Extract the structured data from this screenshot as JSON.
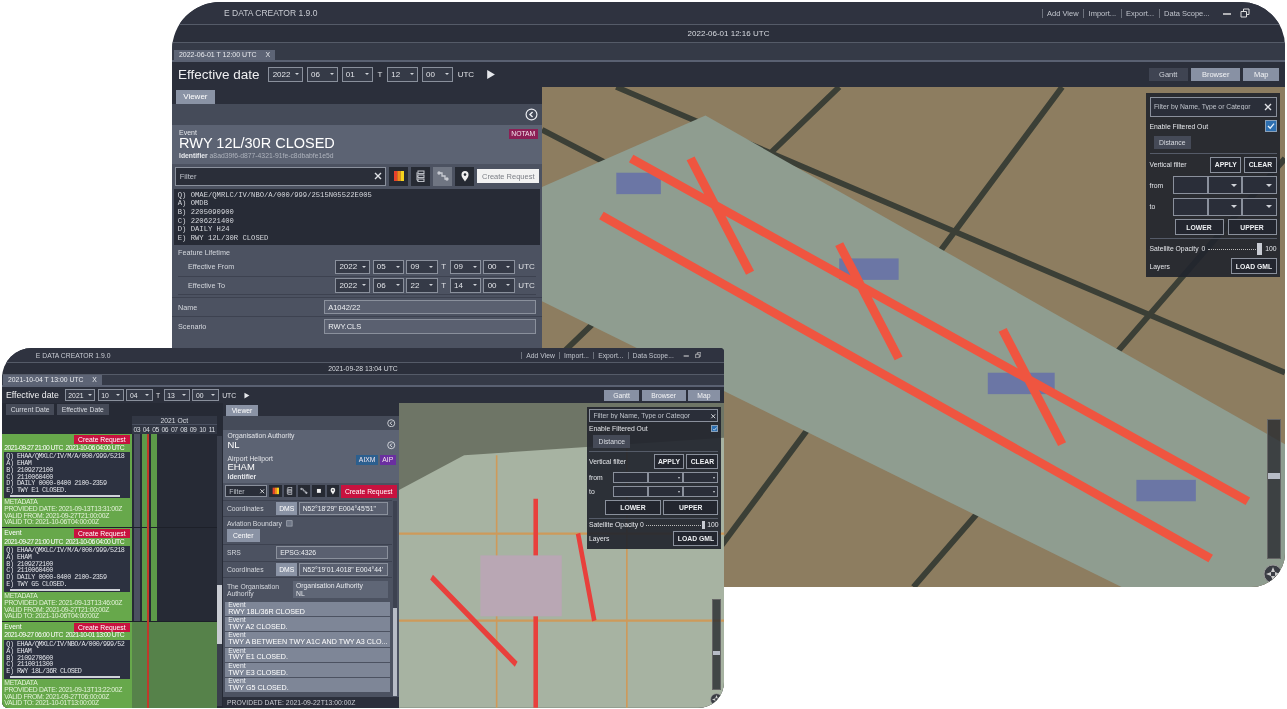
{
  "windows": [
    {
      "kind": "large",
      "app_title": "E DATA CREATOR 1.9.0",
      "menu": [
        "Add View",
        "Import...",
        "Export...",
        "Data Scope..."
      ],
      "clock": "2022-06-01 12:16 UTC",
      "tab": {
        "label": "2022-06-01 T 12:00 UTC",
        "close": "X"
      },
      "effective_date": {
        "label": "Effective date",
        "date": [
          "2022",
          "06",
          "01"
        ],
        "sep": "T",
        "time": [
          "12",
          "00"
        ],
        "zone": "UTC"
      },
      "view_buttons": [
        {
          "label": "Gantt",
          "on": false
        },
        {
          "label": "Browser",
          "on": true
        },
        {
          "label": "Map",
          "on": true
        }
      ],
      "viewer": {
        "tab": {
          "label": "Viewer",
          "selected": true
        },
        "blocks": [
          {
            "kind": "header"
          },
          {
            "kind": "entity",
            "caption": "Event",
            "title": "RWY 12L/30R CLOSED",
            "identifier_label": "Identifier",
            "identifier": "a8ad39f6-d877-4321-91fe-c8dbabfe1e5d",
            "badges": [
              {
                "label": "NOTAM",
                "color": "#8c1f55"
              }
            ]
          },
          {
            "kind": "filter",
            "placeholder": "Filter",
            "primary": false,
            "button": "Create Request",
            "tools": [
              {
                "kind": "palette",
                "disabled": false
              },
              {
                "kind": "tree",
                "disabled": false
              },
              {
                "kind": "link",
                "disabled": true
              },
              {
                "kind": "pin",
                "disabled": false
              }
            ]
          },
          {
            "kind": "notam",
            "lines": [
              "Q) OMAE/QMRLC/IV/NBO/A/000/999/2515N05522E005",
              "A) OMDB",
              "B) 2205090900",
              "C) 2206221400",
              "D) DAILY H24",
              "E) RWY 12L/30R CLOSED"
            ]
          },
          {
            "kind": "lifetime",
            "label": "Feature Lifetime",
            "rows": [
              {
                "label": "Effective From",
                "date": [
                  "2022",
                  "05",
                  "09"
                ],
                "sep": "T",
                "time": [
                  "09",
                  "00"
                ],
                "zone": "UTC"
              },
              {
                "label": "Effective To",
                "date": [
                  "2022",
                  "06",
                  "22"
                ],
                "sep": "T",
                "time": [
                  "14",
                  "00"
                ],
                "zone": "UTC"
              }
            ]
          },
          {
            "kind": "field",
            "label": "Name",
            "value": "A1042/22"
          },
          {
            "kind": "field",
            "label": "Scenario",
            "value": "RWY.CLS"
          }
        ]
      },
      "map": {
        "kind": "city",
        "filter": {
          "placeholder": "Filter by Name, Type or Categor"
        },
        "enable_filtered": {
          "label": "Enable Filtered Out",
          "checked": true
        },
        "distance": "Distance",
        "vertical_filter": {
          "label": "Vertical filter",
          "apply": "APPLY",
          "clear": "CLEAR",
          "from": "from",
          "to": "to",
          "lower": "LOWER",
          "upper": "UPPER"
        },
        "opacity": {
          "label": "Satellite Opacity",
          "min": "0",
          "max": "100",
          "level": 1
        },
        "layers": {
          "label": "Layers",
          "button": "LOAD GML"
        },
        "zoom": {
          "level": 0.6
        }
      }
    },
    {
      "kind": "small",
      "app_title": "E DATA CREATOR 1.9.0",
      "menu": [
        "Add View",
        "Import...",
        "Export...",
        "Data Scope..."
      ],
      "clock": "2021-09-28 13:04 UTC",
      "tab": {
        "label": "2021-10-04 T 13:00 UTC",
        "close": "X"
      },
      "effective_date": {
        "label": "Effective date",
        "date": [
          "2021",
          "10",
          "04"
        ],
        "sep": "T",
        "time": [
          "13",
          "00"
        ],
        "zone": "UTC"
      },
      "view_buttons": [
        {
          "label": "Gantt",
          "on": true
        },
        {
          "label": "Browser",
          "on": true
        },
        {
          "label": "Map",
          "on": true
        }
      ],
      "gantt": {
        "buttons": [
          "Current Date",
          "Effective Date"
        ],
        "month": "2021 Oct",
        "days": [
          "03",
          "04",
          "05",
          "06",
          "07",
          "08",
          "09",
          "10",
          "11"
        ],
        "cards": [
          {
            "kind": "stripes",
            "button": "Create Request",
            "start": "2021-09-27 21:00 UTC",
            "end": "2021-10-06 04:00 UTC",
            "lines": [
              "Q) EHAA/QMXLC/IV/M/A/000/999/5218",
              "A) EHAM",
              "B) 2109272100",
              "C) 2110060400",
              "D) DAILY 0000-0400 2100-2359",
              "E) TWY E1 CLOSED."
            ],
            "metadata": [
              "METADATA",
              "PROVIDED DATE: 2021-09-13T13:31:00Z",
              "VALID FROM: 2021-09-27T21:00:00Z",
              "VALID TO: 2021-10-06T04:00:00Z"
            ]
          },
          {
            "kind": "stripes",
            "caption": "Event",
            "button": "Create Request",
            "start": "2021-09-27 21:00 UTC",
            "end": "2021-10-06 04:00 UTC",
            "lines": [
              "Q) EHAA/QMXLC/IV/M/A/000/999/5218",
              "A) EHAM",
              "B) 2109272100",
              "C) 2110060400",
              "D) DAILY 0000-0400 2100-2359",
              "E) TWY G5 CLOSED."
            ],
            "metadata": [
              "METADATA",
              "PROVIDED DATE: 2021-09-13T13:46:00Z",
              "VALID FROM: 2021-09-27T21:00:00Z",
              "VALID TO: 2021-10-06T04:00:00Z"
            ]
          },
          {
            "kind": "fill",
            "caption": "Event",
            "button": "Create Request",
            "start": "2021-09-27 06:00 UTC",
            "end": "2021-10-01 13:00 UTC",
            "lines": [
              "Q) EHAA/QMXLC/IV/NBO/A/000/999/52",
              "A) EHAM",
              "B) 2109270600",
              "C) 2110011300",
              "E) RWY 18L/36R CLOSED"
            ],
            "metadata": [
              "METADATA",
              "PROVIDED DATE: 2021-09-13T13:22:00Z",
              "VALID FROM: 2021-09-27T06:00:00Z",
              "VALID TO: 2021-10-01T13:00:00Z"
            ]
          }
        ]
      },
      "viewer": {
        "tab": {
          "label": "Viewer",
          "selected": true
        },
        "blocks": [
          {
            "kind": "header"
          },
          {
            "kind": "entity",
            "caption": "Organisation Authority",
            "title": "NL",
            "nav": true
          },
          {
            "kind": "entity",
            "caption": "Airport Heliport",
            "title": "EHAM",
            "identifier_label": "Identifier",
            "badges": [
              {
                "label": "AIXM",
                "color": "#2c5f8e"
              },
              {
                "label": "AIP",
                "color": "#6a2fa0"
              }
            ]
          },
          {
            "kind": "filter",
            "placeholder": "Filter",
            "primary": true,
            "button": "Create Request",
            "tools": [
              {
                "kind": "palette",
                "disabled": false
              },
              {
                "kind": "tree",
                "disabled": false
              },
              {
                "kind": "link",
                "disabled": false
              },
              {
                "kind": "square",
                "disabled": false
              },
              {
                "kind": "pin",
                "disabled": false
              }
            ]
          },
          {
            "kind": "scroll",
            "blocks": [
              {
                "kind": "field",
                "label": "Coordinates",
                "tag": "DMS",
                "value": "N52°18'29\" E004°45'51\""
              },
              {
                "kind": "boundary",
                "label": "Aviation Boundary",
                "button": "Center"
              },
              {
                "kind": "field",
                "label": "SRS",
                "value": "EPSG:4326"
              },
              {
                "kind": "field",
                "label": "Coordinates",
                "tag": "DMS",
                "value": "N52°19'01.4018\" E004°44'"
              },
              {
                "kind": "ref",
                "label": "The Organisation Authority",
                "caption": "Organisation Authority",
                "value": "NL"
              },
              {
                "kind": "events",
                "items": [
                  {
                    "caption": "Event",
                    "title": "RWY 18L/36R CLOSED"
                  },
                  {
                    "caption": "Event",
                    "title": "TWY A2 CLOSED."
                  },
                  {
                    "caption": "Event",
                    "title": "TWY A BETWEEN TWY A1C AND TWY A3 CLO..."
                  },
                  {
                    "caption": "Event",
                    "title": "TWY E1 CLOSED."
                  },
                  {
                    "caption": "Event",
                    "title": "TWY E3 CLOSED."
                  },
                  {
                    "caption": "Event",
                    "title": "TWY G5 CLOSED."
                  }
                ]
              }
            ]
          },
          {
            "kind": "footer",
            "text": "PROVIDED DATE: 2021-09-22T13:00:00Z"
          }
        ]
      },
      "map": {
        "kind": "field",
        "filter": {
          "placeholder": "Filter by Name, Type or Categor"
        },
        "enable_filtered": {
          "label": "Enable Filtered Out",
          "checked": true
        },
        "distance": "Distance",
        "vertical_filter": {
          "label": "Vertical filter",
          "apply": "APPLY",
          "clear": "CLEAR",
          "from": "from",
          "to": "to",
          "lower": "LOWER",
          "upper": "UPPER"
        },
        "opacity": {
          "label": "Satellite Opacity",
          "min": "0",
          "max": "100",
          "level": 1
        },
        "layers": {
          "label": "Layers",
          "button": "LOAD GML"
        },
        "zoom": {
          "level": 0.4
        }
      }
    }
  ]
}
